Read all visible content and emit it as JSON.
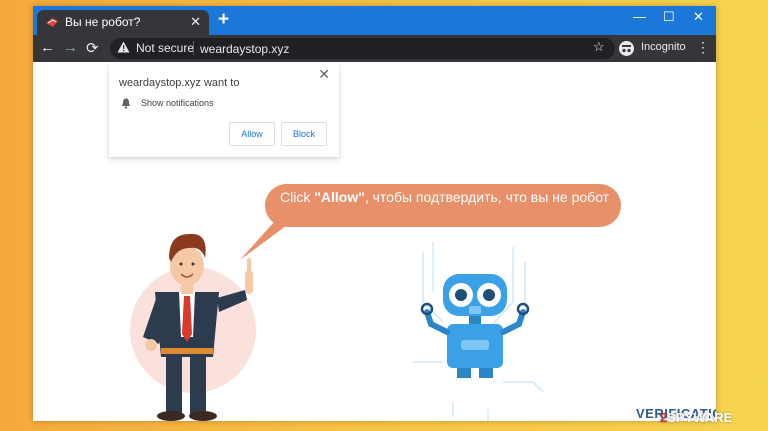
{
  "tab": {
    "title": "Вы не робот?",
    "close": "✕"
  },
  "new_tab": "+",
  "window_controls": {
    "minimize": "—",
    "maximize": "☐",
    "close": "✕"
  },
  "toolbar": {
    "back": "←",
    "forward": "→",
    "reload": "⟳",
    "not_secure": "Not secure",
    "url": "weardaystop.xyz",
    "bookmark": "☆",
    "incognito": "Incognito",
    "menu": "⋮"
  },
  "popup": {
    "title": "weardaystop.xyz want to",
    "close": "✕",
    "notification_text": "Show notifications",
    "allow": "Allow",
    "block": "Block"
  },
  "bubble": {
    "prefix": "Click ",
    "bold": "\"Allow\"",
    "suffix": ", чтобы подтвердить, что вы не робот"
  },
  "verification": "VERIFICATION",
  "watermark": {
    "two": "2",
    "rest": "SPYWARE"
  },
  "colors": {
    "tabbar": "#1b78d8",
    "toolbar": "#35363a",
    "bubble": "#e8906a",
    "link_blue": "#1a73e8",
    "robot_blue": "#3aa1e6"
  },
  "icons": [
    "warning-icon",
    "bell-icon",
    "incognito-icon",
    "star-icon",
    "favicon"
  ]
}
